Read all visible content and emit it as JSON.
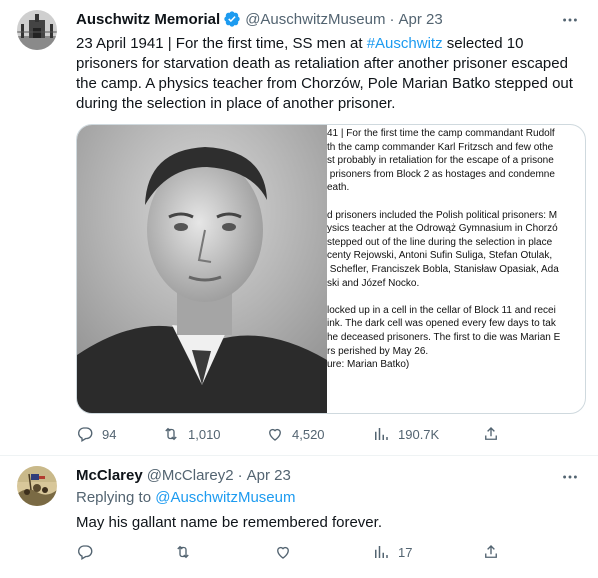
{
  "tweet1": {
    "author_name": "Auschwitz Memorial",
    "author_handle": "@AuschwitzMuseum",
    "date": "Apr 23",
    "text_before": "23 April 1941 | For the first time, SS men at ",
    "hashtag": "#Auschwitz",
    "text_after": " selected 10 prisoners for starvation death as retaliation after another prisoner escaped the camp. A physics teacher from Chorzów, Pole Marian Batko stepped out during the selection in place of another prisoner.",
    "image_caption": "41 | For the first time the camp commandant Rudolf\nth the camp commander Karl Fritzsch and few othe\nst probably in retaliation for the escape of a prisone\n prisoners from Block 2 as hostages and condemne\neath.\n\nd prisoners included the Polish political prisoners: M\nysics teacher at the Odrowąż Gymnasium in Chorzó\nstepped out of the line during the selection in place\ncenty Rejowski, Antoni Sufin Suliga, Stefan Otulak,\n Schefler, Franciszek Bobla, Stanisław Opasiak, Ada\nski and Józef Nocko.\n\nlocked up in a cell in the cellar of Block 11 and recei\nink. The dark cell was opened every few days to tak\nhe deceased prisoners. The first to die was Marian E\nrs perished by May 26.\nure: Marian Batko)",
    "replies": "94",
    "retweets": "1,010",
    "likes": "4,520",
    "views": "190.7K"
  },
  "tweet2": {
    "author_name": "McClarey",
    "author_handle": "@McClarey2",
    "date": "Apr 23",
    "replying_label": "Replying to ",
    "replying_to": "@AuschwitzMuseum",
    "text": "May his gallant name be remembered forever.",
    "views": "17"
  },
  "dot": "·",
  "colors": {
    "accent": "#1d9bf0",
    "muted": "#536471",
    "text": "#0f1419"
  }
}
